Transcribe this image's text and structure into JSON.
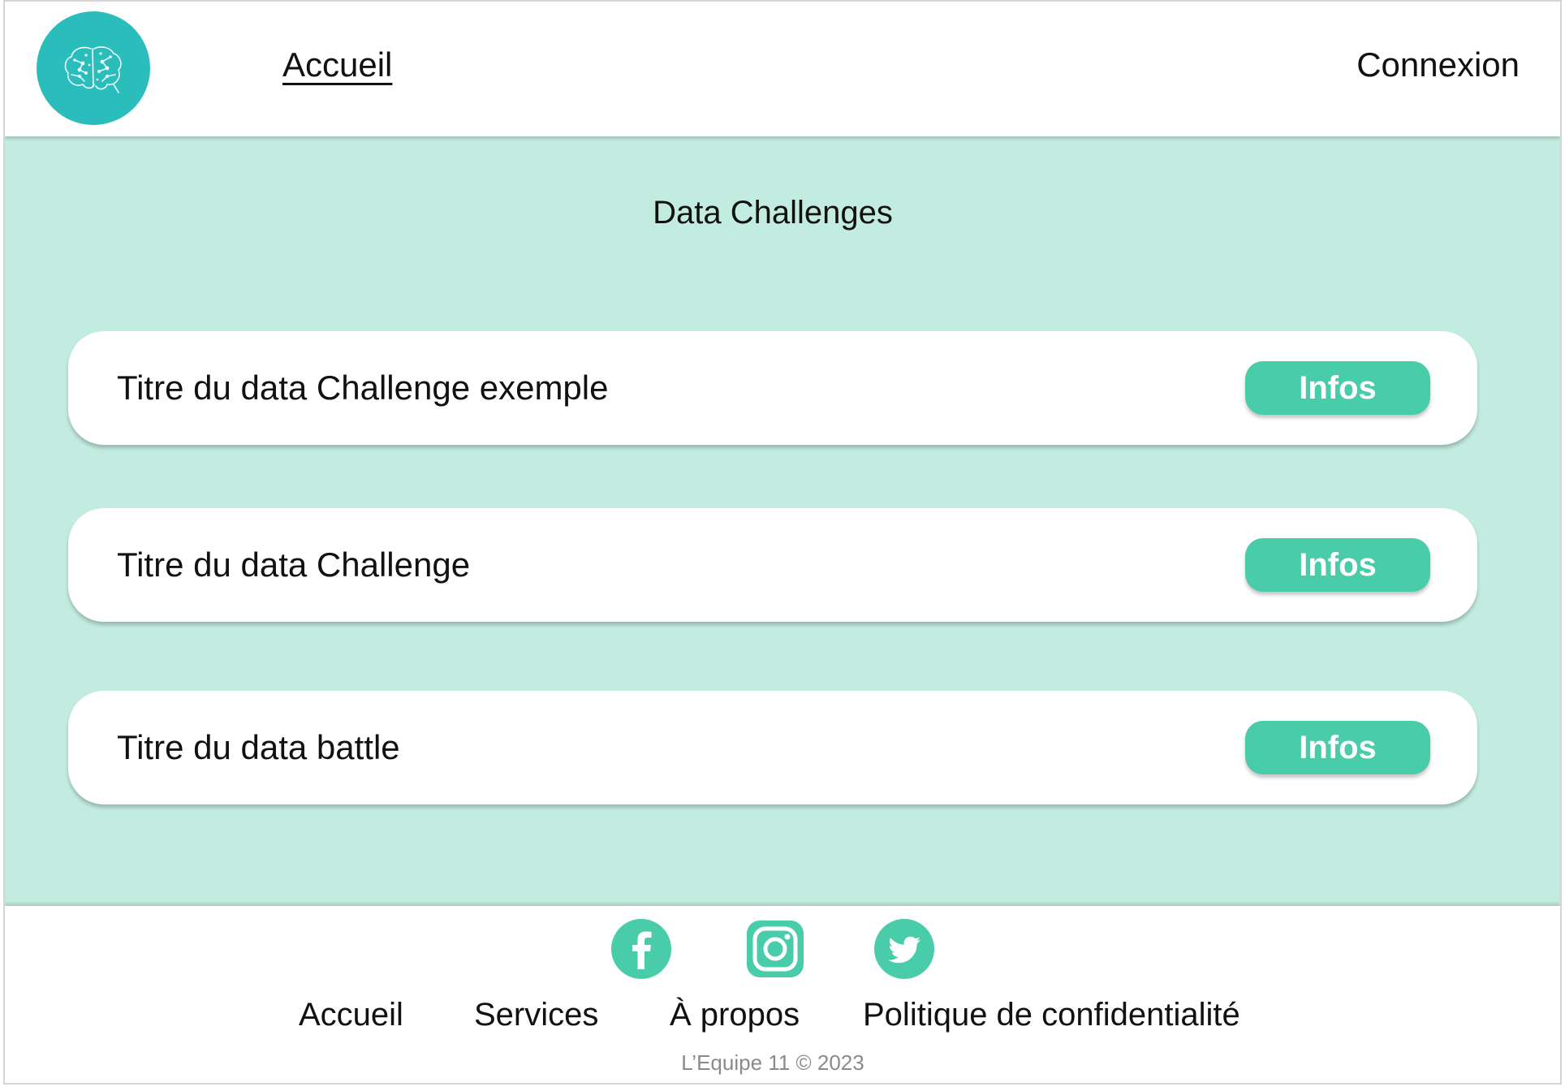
{
  "header": {
    "logo_icon": "brain-icon",
    "nav_home": "Accueil",
    "nav_login": "Connexion"
  },
  "main": {
    "title": "Data Challenges",
    "challenges": [
      {
        "title": "Titre du data Challenge exemple",
        "button": "Infos"
      },
      {
        "title": "Titre du data Challenge",
        "button": "Infos"
      },
      {
        "title": "Titre du data battle",
        "button": "Infos"
      }
    ]
  },
  "footer": {
    "social": [
      "facebook-icon",
      "instagram-icon",
      "twitter-icon"
    ],
    "links": [
      "Accueil",
      "Services",
      "À propos",
      "Politique de confidentialité"
    ],
    "copyright": "L’Equipe 11 © 2023"
  },
  "colors": {
    "logo_teal": "#2bbdbc",
    "main_bg": "#c3ece1",
    "accent_green": "#48cca9"
  }
}
